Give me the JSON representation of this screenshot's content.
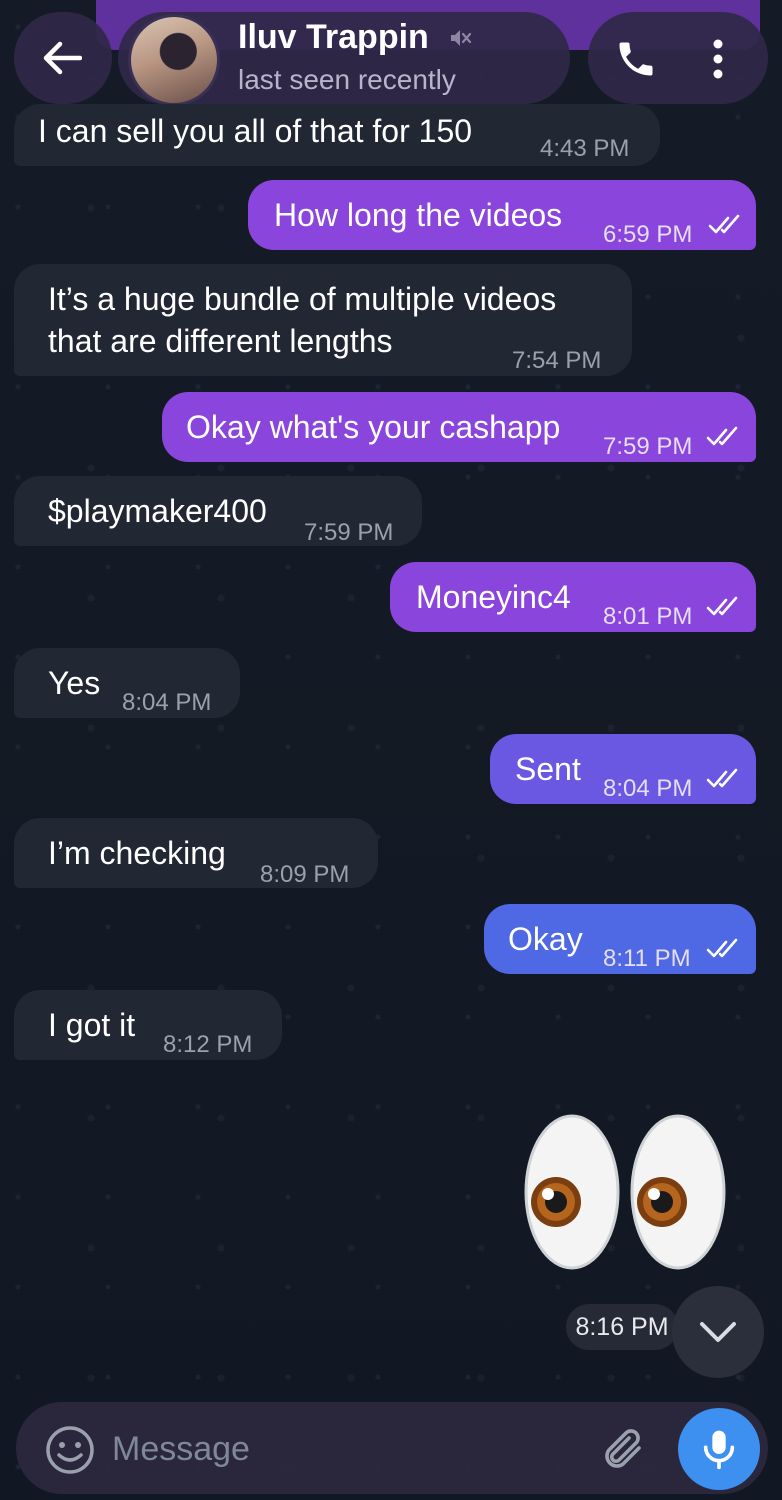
{
  "header": {
    "name": "Iluv Trappin",
    "status": "last seen recently"
  },
  "messages": [
    {
      "text": "I can sell you all of that for 150",
      "time": "4:43 PM",
      "dir": "in"
    },
    {
      "text": "How long the videos",
      "time": "6:59 PM",
      "dir": "out"
    },
    {
      "text_line1": "It’s a huge bundle of multiple videos",
      "text_line2": "that are different lengths",
      "time": "7:54 PM",
      "dir": "in"
    },
    {
      "text": "Okay what's your cashapp",
      "time": "7:59 PM",
      "dir": "out"
    },
    {
      "text": "$playmaker400",
      "time": "7:59 PM",
      "dir": "in"
    },
    {
      "text": "Moneyinc4",
      "time": "8:01 PM",
      "dir": "out"
    },
    {
      "text": "Yes",
      "time": "8:04 PM",
      "dir": "in"
    },
    {
      "text": "Sent",
      "time": "8:04 PM",
      "dir": "out"
    },
    {
      "text": "I’m checking",
      "time": "8:09 PM",
      "dir": "in"
    },
    {
      "text": "Okay",
      "time": "8:11 PM",
      "dir": "out"
    },
    {
      "text": "I got it",
      "time": "8:12 PM",
      "dir": "in"
    }
  ],
  "sticker": {
    "emoji": "eyes-emoji",
    "time": "8:16 PM"
  },
  "composer": {
    "placeholder": "Message"
  },
  "icons": {
    "back": "arrow-left-icon",
    "mute": "muted-icon",
    "call": "phone-icon",
    "menu": "more-vertical-icon",
    "scroll_down": "chevron-down-icon",
    "emoji": "smiley-icon",
    "attach": "paperclip-icon",
    "mic": "microphone-icon"
  },
  "colors": {
    "background": "#141a24",
    "incoming_bubble": "#212733",
    "outgoing_purple": "#8a45dd",
    "outgoing_blue": "#4f68e3",
    "mic_button": "#3d8ff0"
  }
}
